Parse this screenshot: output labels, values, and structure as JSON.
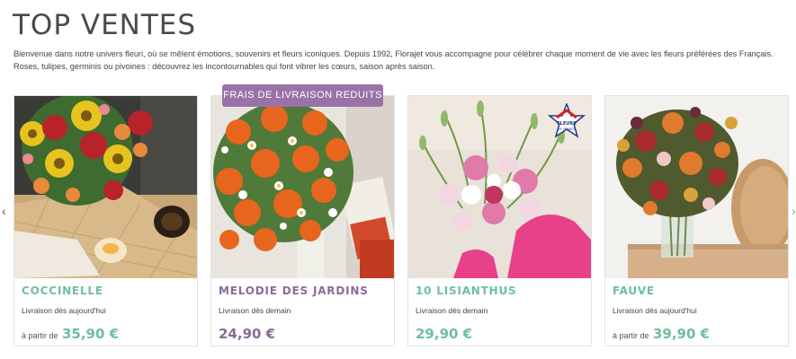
{
  "page": {
    "title": "TOP VENTES",
    "intro": "Bienvenue dans notre univers fleuri, où se mêlent émotions, souvenirs et fleurs iconiques. Depuis 1992, Florajet vous accompagne pour célébrer chaque moment de vie avec les fleurs préférées des Français. Roses, tulipes, germinis ou pivoines : découvrez les incontournables qui font vibrer les cœurs, saison après saison."
  },
  "carousel": {
    "prev_icon": "chevron-left-icon",
    "next_icon": "chevron-right-icon",
    "prev_glyph": "‹",
    "next_glyph": "›"
  },
  "products": [
    {
      "name": "COCCINELLE",
      "delivery": "Livraison dès aujourd'hui",
      "from": "à partir de",
      "price": "35,90 €",
      "name_color": "#6fbf9a",
      "price_color": "#6fbf9a"
    },
    {
      "name": "MELODIE DES JARDINS",
      "delivery": "Livraison dès demain",
      "from": "",
      "price": "24,90 €",
      "badge": "FRAIS DE LIVRAISON REDUITS",
      "name_color": "#8a6a9a",
      "price_color": "#8a6a9a"
    },
    {
      "name": "10 LISIANTHUS",
      "delivery": "Livraison dès demain",
      "from": "",
      "price": "29,90 €",
      "label": "FLEURS DE FRANCE",
      "name_color": "#6fbf9a",
      "price_color": "#6fbf9a"
    },
    {
      "name": "FAUVE",
      "delivery": "Livraison dès aujourd'hui",
      "from": "à partir de",
      "price": "39,90 €",
      "name_color": "#6fbf9a",
      "price_color": "#6fbf9a"
    }
  ],
  "colors": {
    "promo_badge": "#9a72a8",
    "mint": "#6fbf9a",
    "mauve": "#8a6a9a"
  }
}
